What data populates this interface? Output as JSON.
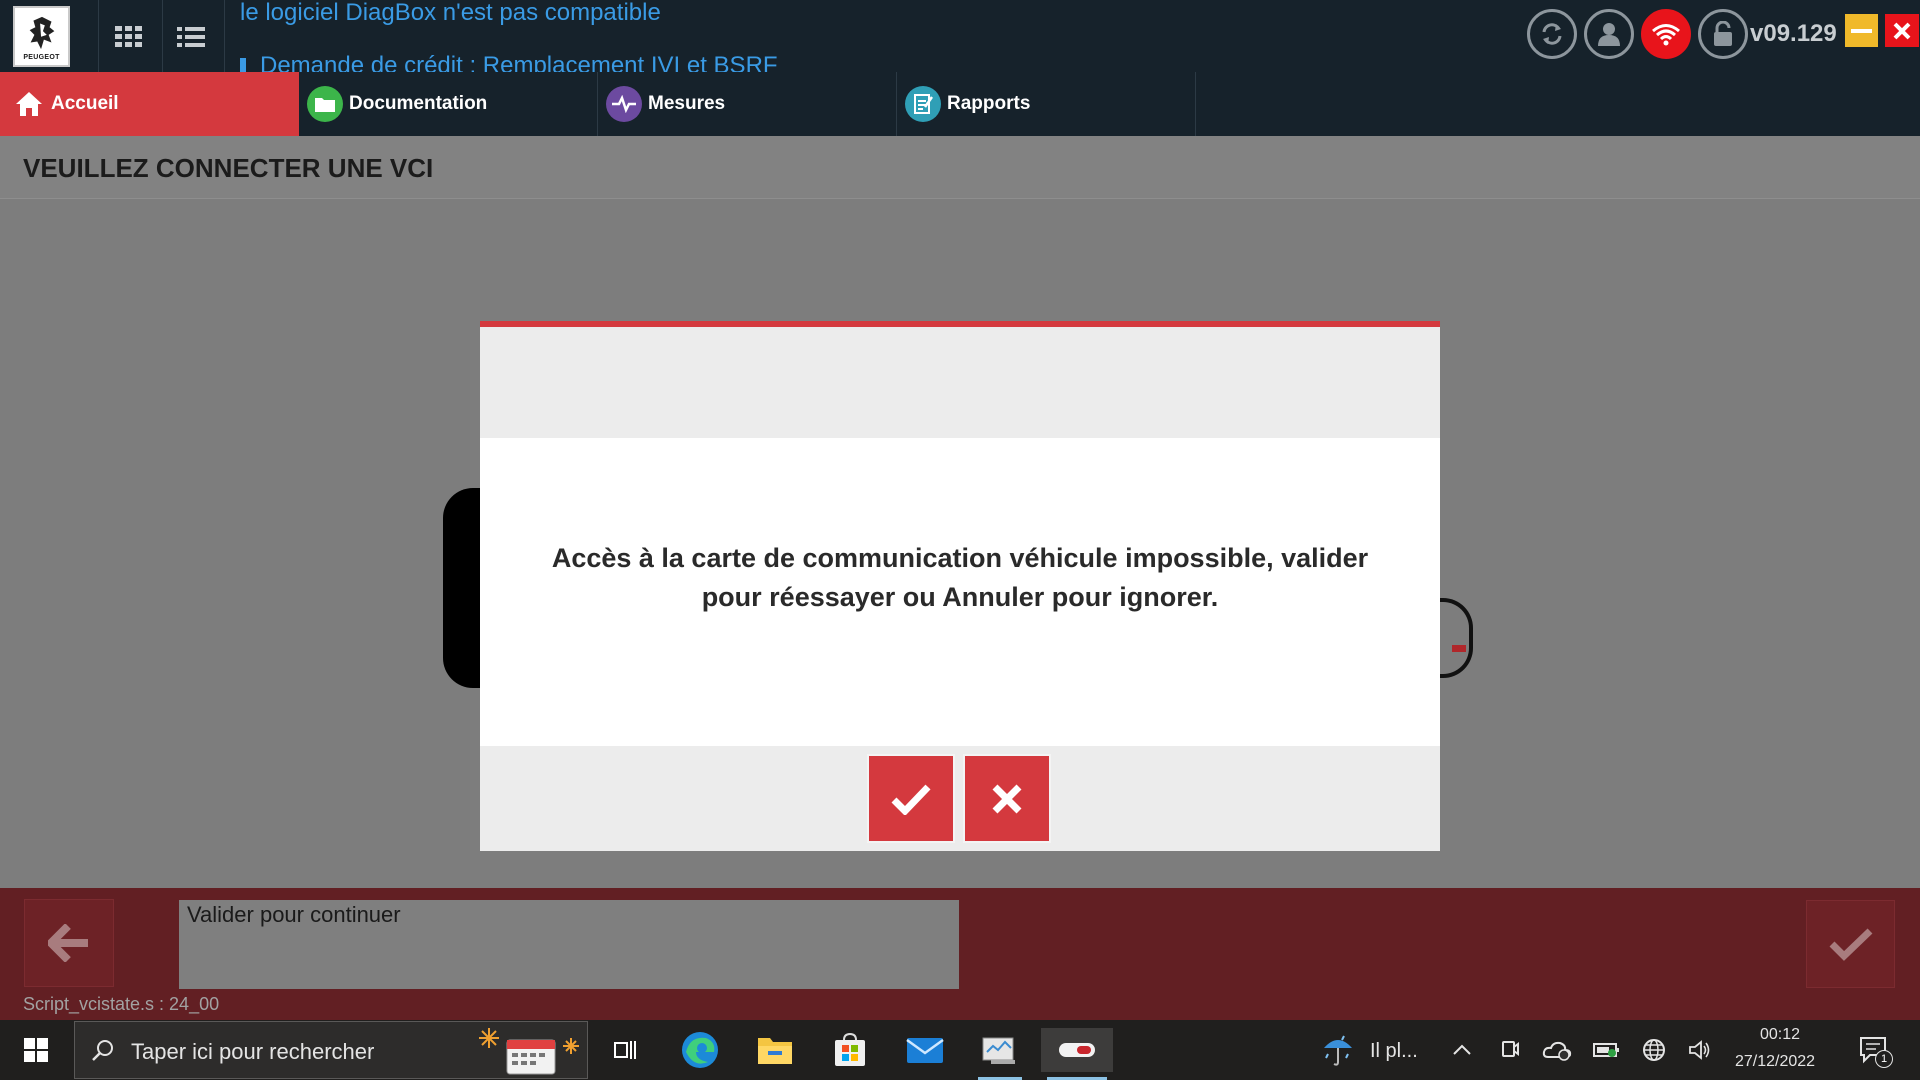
{
  "header": {
    "logo_text": "PEUGEOT",
    "news": [
      "le logiciel DiagBox n'est pas compatible",
      "Demande de crédit : Remplacement IVI et BSRF"
    ],
    "version": "v09.129",
    "icons": [
      "apps-grid-icon",
      "list-icon",
      "sync-icon",
      "user-icon",
      "wifi-icon",
      "unlock-icon",
      "minimize-icon",
      "close-icon"
    ]
  },
  "nav": {
    "tabs": [
      {
        "label": "Accueil",
        "icon": "home-icon",
        "active": true
      },
      {
        "label": "Documentation",
        "icon": "folder-icon",
        "color": "#3cb54a"
      },
      {
        "label": "Mesures",
        "icon": "pulse-icon",
        "color": "#6c4aa0"
      },
      {
        "label": "Rapports",
        "icon": "report-icon",
        "color": "#2f9fb6"
      }
    ]
  },
  "page": {
    "title": "VEUILLEZ CONNECTER UNE VCI"
  },
  "dialog": {
    "message": "Accès à la carte de communication véhicule impossible, valider pour réessayer ou Annuler pour ignorer.",
    "confirm_icon": "check-icon",
    "cancel_icon": "cross-icon"
  },
  "footer": {
    "status_text": "Valider pour continuer",
    "script_info": "Script_vcistate.s : 24_00",
    "back_icon": "arrow-left-icon",
    "ok_icon": "check-icon"
  },
  "taskbar": {
    "search_placeholder": "Taper ici pour rechercher",
    "weather_text": "Il pl...",
    "time": "00:12",
    "date": "27/12/2022",
    "notification_count": "1"
  },
  "colors": {
    "accent_red": "#d4393e",
    "top_bg": "#16222b",
    "bottom_bar": "#621f23",
    "news_blue": "#3a9be5",
    "wifi_red": "#e8141b",
    "minimize_yellow": "#f0b92a"
  }
}
